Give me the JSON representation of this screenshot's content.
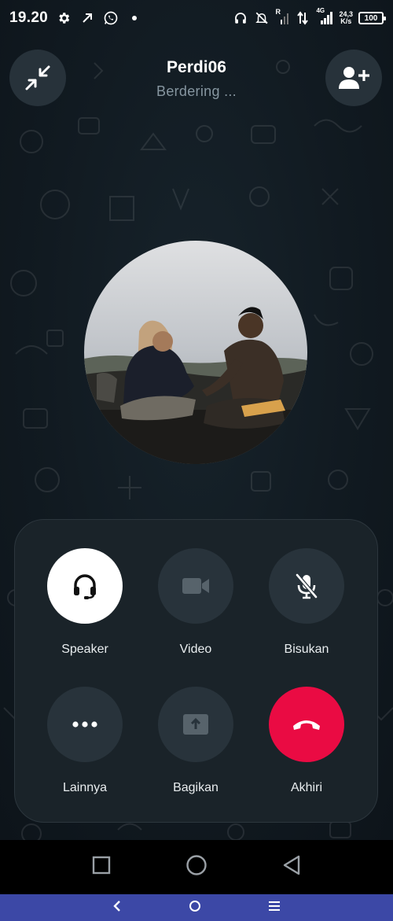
{
  "status_bar": {
    "time": "19.20",
    "net_speed_value": "24,3",
    "net_speed_unit": "K/s",
    "battery": "100",
    "signal_badge": "R",
    "network_type": "4G"
  },
  "call": {
    "caller_name": "Perdi06",
    "status": "Berdering ..."
  },
  "controls": [
    {
      "label": "Speaker",
      "icon": "headset-icon"
    },
    {
      "label": "Video",
      "icon": "video-camera-icon"
    },
    {
      "label": "Bisukan",
      "icon": "mic-off-icon"
    },
    {
      "label": "Lainnya",
      "icon": "more-dots-icon"
    },
    {
      "label": "Bagikan",
      "icon": "share-screen-icon"
    },
    {
      "label": "Akhiri",
      "icon": "end-call-icon"
    }
  ],
  "colors": {
    "end_call": "#ea0b43",
    "speaker_active": "#ffffff",
    "control_bg": "#28333b",
    "panel_bg": "#1a2329",
    "bottom_bar": "#3c48a6"
  }
}
